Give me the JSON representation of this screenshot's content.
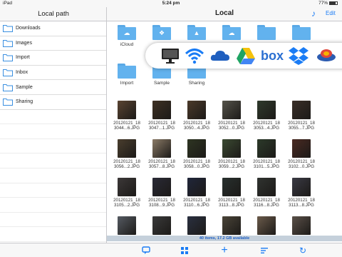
{
  "status_bar": {
    "device": "iPad",
    "time": "5:24 pm",
    "battery": "77%"
  },
  "left_panel": {
    "title": "Local path",
    "items": [
      {
        "label": "Downloads"
      },
      {
        "label": "Images"
      },
      {
        "label": "Import"
      },
      {
        "label": "Inbox"
      },
      {
        "label": "Sample"
      },
      {
        "label": "Sharing"
      }
    ]
  },
  "right_panel": {
    "title": "Local",
    "edit_label": "Edit",
    "music_icon": "music-note-icon",
    "folders": [
      {
        "label": "iCloud",
        "glyph": "☁"
      },
      {
        "label": "",
        "glyph": "❖"
      },
      {
        "label": "",
        "glyph": "▲"
      },
      {
        "label": "",
        "glyph": "☁"
      },
      {
        "label": "",
        "glyph": ""
      },
      {
        "label": "",
        "glyph": ""
      },
      {
        "label": "Import",
        "glyph": ""
      },
      {
        "label": "Sample",
        "glyph": ""
      },
      {
        "label": "Sharing",
        "glyph": ""
      }
    ],
    "files": [
      {
        "line1": "20120121_18",
        "line2": "3044...6.JPG",
        "color": "#5a4432"
      },
      {
        "line1": "20120121_18",
        "line2": "3047...1.JPG",
        "color": "#3e3124"
      },
      {
        "line1": "20120121_18",
        "line2": "3050...4.JPG",
        "color": "#4b3a2a"
      },
      {
        "line1": "20120121_18",
        "line2": "3052...0.JPG",
        "color": "#55534a"
      },
      {
        "line1": "20120121_18",
        "line2": "3053...4.JPG",
        "color": "#2f3a2c"
      },
      {
        "line1": "20120121_18",
        "line2": "3055...7.JPG",
        "color": "#3a2f28"
      },
      {
        "line1": "20120121_18",
        "line2": "3056...2.JPG",
        "color": "#4a3e2e"
      },
      {
        "line1": "20120121_18",
        "line2": "3057...8.JPG",
        "color": "#8a7a66"
      },
      {
        "line1": "20120121_18",
        "line2": "3058...0.JPG",
        "color": "#2e3522"
      },
      {
        "line1": "20120121_18",
        "line2": "3059...2.JPG",
        "color": "#3b4a32"
      },
      {
        "line1": "20120121_18",
        "line2": "3101...5.JPG",
        "color": "#2c3a2a"
      },
      {
        "line1": "20120121_18",
        "line2": "3102...0.JPG",
        "color": "#4a2a22"
      },
      {
        "line1": "20120121_18",
        "line2": "3105...2.JPG",
        "color": "#3c3838"
      },
      {
        "line1": "20120121_18",
        "line2": "3108...9.JPG",
        "color": "#2a2a36"
      },
      {
        "line1": "20120121_18",
        "line2": "3110...6.JPG",
        "color": "#20263a"
      },
      {
        "line1": "20120121_18",
        "line2": "3113...8.JPG",
        "color": "#28302e"
      },
      {
        "line1": "20120121_18",
        "line2": "3116...8.JPG",
        "color": "#303330"
      },
      {
        "line1": "20120121_18",
        "line2": "3113...8.JPG",
        "color": "#3a3a44"
      },
      {
        "line1": "",
        "line2": "",
        "color": "#555a62"
      },
      {
        "line1": "",
        "line2": "",
        "color": "#3a3a3a"
      },
      {
        "line1": "",
        "line2": "",
        "color": "#2a3040"
      },
      {
        "line1": "",
        "line2": "",
        "color": "#4a4438"
      },
      {
        "line1": "",
        "line2": "",
        "color": "#6a5a4a"
      },
      {
        "line1": "",
        "line2": "",
        "color": "#5a5048"
      }
    ],
    "status_text": "40 items, 17.2 GB available"
  },
  "cloud_services": [
    {
      "name": "computer-icon",
      "color": "#222222"
    },
    {
      "name": "wifi-icon",
      "color": "#1a7cf5"
    },
    {
      "name": "onedrive-icon",
      "color": "#1f5fbf"
    },
    {
      "name": "google-drive-icon",
      "color": "#34a853"
    },
    {
      "name": "box-icon",
      "color": "#2a6fd1",
      "text": "box"
    },
    {
      "name": "dropbox-icon",
      "color": "#1a7cf5"
    },
    {
      "name": "other-cloud-icon",
      "color": "#2c5bb0"
    }
  ],
  "toolbar": {
    "buttons": [
      {
        "name": "chat-icon",
        "glyph": "⊟"
      },
      {
        "name": "grid-view-icon",
        "glyph": "▦"
      },
      {
        "name": "add-icon",
        "glyph": "+"
      },
      {
        "name": "sort-icon",
        "glyph": "≡"
      },
      {
        "name": "refresh-icon",
        "glyph": "↻"
      }
    ]
  },
  "colors": {
    "accent": "#1a7cf5",
    "folder": "#62b2ee"
  }
}
